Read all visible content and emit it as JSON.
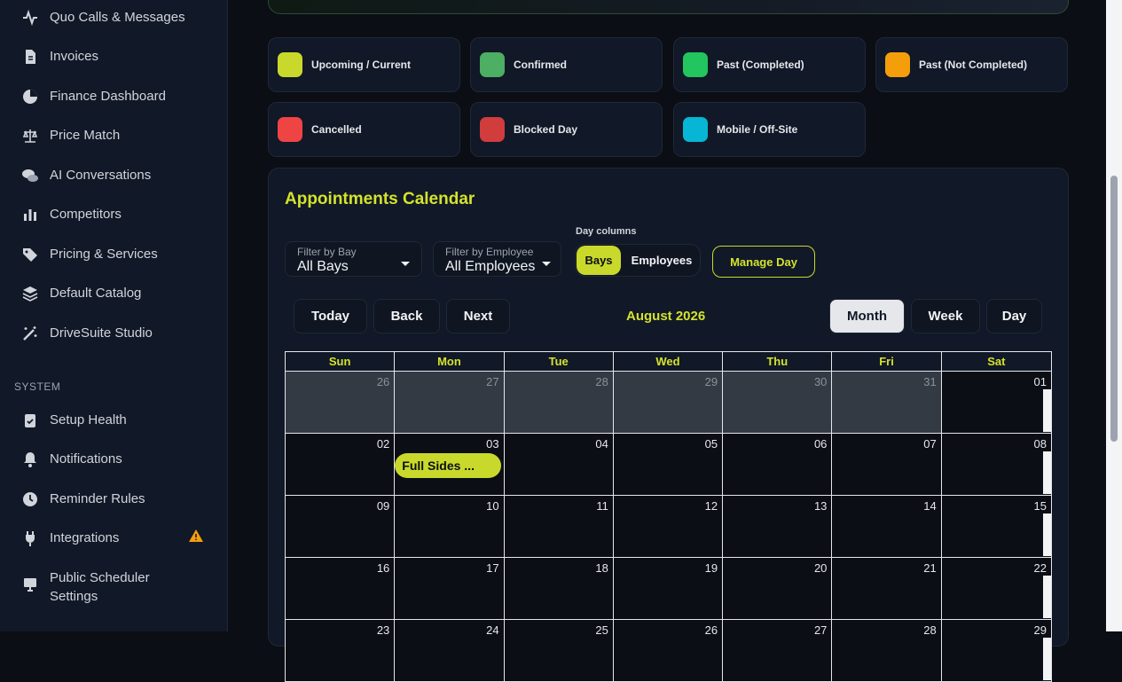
{
  "sidebar": {
    "items": [
      {
        "label": "Quo Calls & Messages",
        "icon": "pulse-icon"
      },
      {
        "label": "Invoices",
        "icon": "document-icon"
      },
      {
        "label": "Finance Dashboard",
        "icon": "pie-chart-icon"
      },
      {
        "label": "Price Match",
        "icon": "scale-icon"
      },
      {
        "label": "AI Conversations",
        "icon": "chat-icon"
      },
      {
        "label": "Competitors",
        "icon": "bar-chart-icon"
      },
      {
        "label": "Pricing & Services",
        "icon": "tag-icon"
      },
      {
        "label": "Default Catalog",
        "icon": "layers-icon"
      },
      {
        "label": "DriveSuite Studio",
        "icon": "magic-wand-icon"
      }
    ],
    "section": "SYSTEM",
    "system_items": [
      {
        "label": "Setup Health",
        "icon": "clipboard-check-icon"
      },
      {
        "label": "Notifications",
        "icon": "bell-icon"
      },
      {
        "label": "Reminder Rules",
        "icon": "clock-icon"
      },
      {
        "label": "Integrations",
        "icon": "plug-icon",
        "warning": true
      },
      {
        "label_1": "Public Scheduler",
        "label_2": "Settings",
        "icon": "monitor-icon"
      }
    ]
  },
  "legend": [
    {
      "label": "Upcoming / Current",
      "color": "#c9d92b"
    },
    {
      "label": "Confirmed",
      "color": "#4caf63"
    },
    {
      "label": "Past (Completed)",
      "color": "#22c55e"
    },
    {
      "label": "Past (Not Completed)",
      "color": "#f59e0b"
    },
    {
      "label": "Cancelled",
      "color": "#ef4444"
    },
    {
      "label": "Blocked Day",
      "color": "#d13c3c"
    },
    {
      "label": "Mobile / Off-Site",
      "color": "#06b6d4"
    }
  ],
  "calendar": {
    "title": "Appointments Calendar",
    "filter_bay": {
      "caption": "Filter by Bay",
      "value": "All Bays"
    },
    "filter_employee": {
      "caption": "Filter by Employee",
      "value": "All Employees"
    },
    "day_columns": {
      "caption": "Day columns",
      "bays": "Bays",
      "employees": "Employees"
    },
    "manage_day": "Manage Day",
    "nav": {
      "today": "Today",
      "back": "Back",
      "next": "Next"
    },
    "month_label": "August 2026",
    "views": {
      "month": "Month",
      "week": "Week",
      "day": "Day",
      "active": "month"
    },
    "weekdays": [
      "Sun",
      "Mon",
      "Tue",
      "Wed",
      "Thu",
      "Fri",
      "Sat"
    ],
    "weeks": [
      [
        "26",
        "27",
        "28",
        "29",
        "30",
        "31",
        "01"
      ],
      [
        "02",
        "03",
        "04",
        "05",
        "06",
        "07",
        "08"
      ],
      [
        "09",
        "10",
        "11",
        "12",
        "13",
        "14",
        "15"
      ],
      [
        "16",
        "17",
        "18",
        "19",
        "20",
        "21",
        "22"
      ],
      [
        "23",
        "24",
        "25",
        "26",
        "27",
        "28",
        "29"
      ]
    ],
    "event": {
      "label": "Full Sides ...",
      "date": "03"
    }
  }
}
